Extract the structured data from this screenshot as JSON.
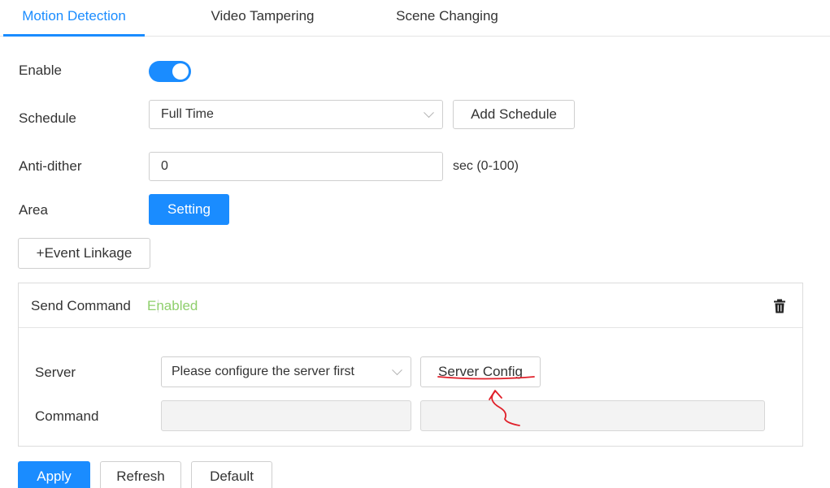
{
  "tabs": [
    {
      "label": "Motion Detection",
      "active": true
    },
    {
      "label": "Video Tampering",
      "active": false
    },
    {
      "label": "Scene Changing",
      "active": false
    }
  ],
  "form": {
    "enable_label": "Enable",
    "enable_on": true,
    "schedule_label": "Schedule",
    "schedule_value": "Full Time",
    "add_schedule_label": "Add Schedule",
    "antidither_label": "Anti-dither",
    "antidither_value": "0",
    "antidither_unit": "sec (0-100)",
    "area_label": "Area",
    "setting_label": "Setting",
    "event_linkage_label": "+Event Linkage"
  },
  "command_panel": {
    "title": "Send Command",
    "status": "Enabled",
    "server_label": "Server",
    "server_value": "Please configure the server first",
    "server_config_label": "Server Config",
    "command_label": "Command",
    "command_value": "",
    "command_extra_value": ""
  },
  "footer": {
    "apply_label": "Apply",
    "refresh_label": "Refresh",
    "default_label": "Default"
  },
  "colors": {
    "accent": "#1a8cff",
    "enabled_status": "#8fcf6d",
    "annotation": "#e0202a"
  }
}
